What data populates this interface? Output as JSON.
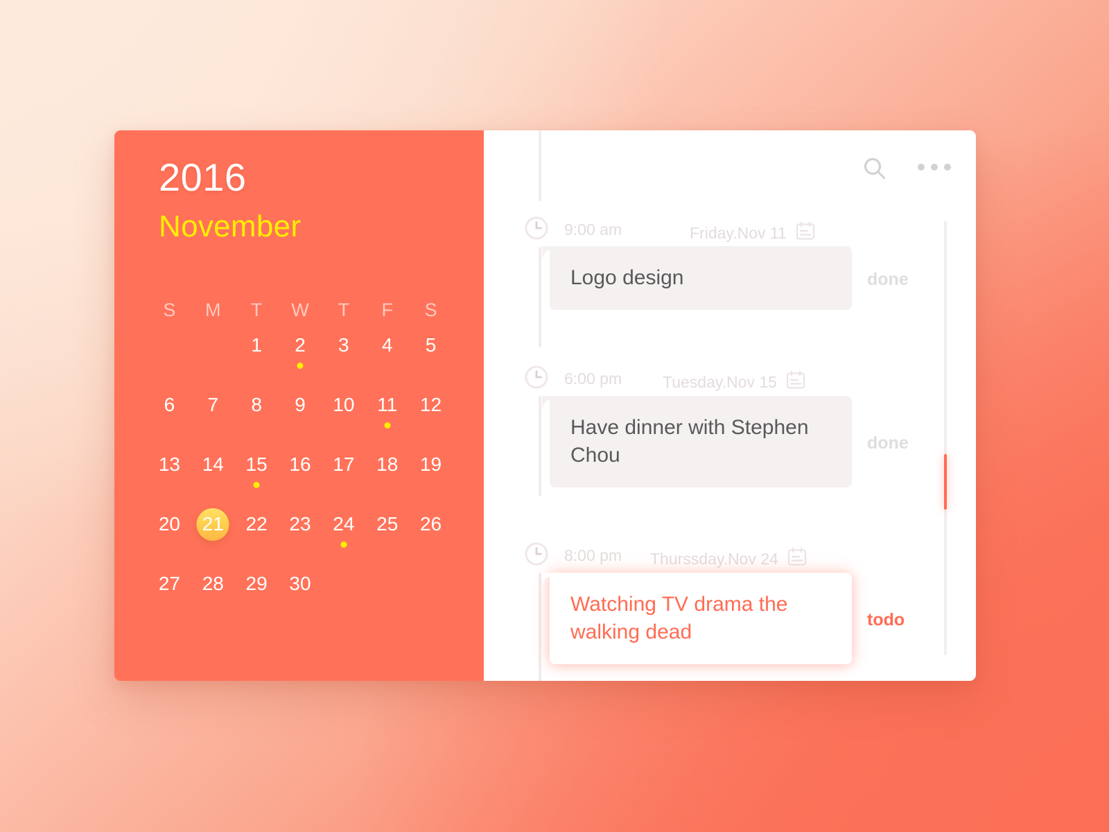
{
  "theme": {
    "panel_orange": "#FF7259",
    "accent_yellow": "#FFEF00",
    "selected_day_gradient_top": "#FFE067",
    "selected_day_gradient_bottom": "#FDB743",
    "todo_color": "#FF6C53",
    "done_color": "#DEDEDE",
    "card_bg": "#F5F1F1",
    "bg_gradient_from": "#FDE9DA",
    "bg_gradient_to": "#FB6E56"
  },
  "calendar": {
    "year": "2016",
    "month": "November",
    "weekday_headers": [
      "S",
      "M",
      "T",
      "W",
      "T",
      "F",
      "S"
    ],
    "leading_blanks": 2,
    "selected_day": 21,
    "days_with_events": [
      2,
      11,
      15,
      24
    ],
    "days": [
      {
        "num": "1"
      },
      {
        "num": "2"
      },
      {
        "num": "3"
      },
      {
        "num": "4"
      },
      {
        "num": "5"
      },
      {
        "num": "6"
      },
      {
        "num": "7"
      },
      {
        "num": "8"
      },
      {
        "num": "9"
      },
      {
        "num": "10"
      },
      {
        "num": "11"
      },
      {
        "num": "12"
      },
      {
        "num": "13"
      },
      {
        "num": "14"
      },
      {
        "num": "15"
      },
      {
        "num": "16"
      },
      {
        "num": "17"
      },
      {
        "num": "18"
      },
      {
        "num": "19"
      },
      {
        "num": "20"
      },
      {
        "num": "21"
      },
      {
        "num": "22"
      },
      {
        "num": "23"
      },
      {
        "num": "24"
      },
      {
        "num": "25"
      },
      {
        "num": "26"
      },
      {
        "num": "27"
      },
      {
        "num": "28"
      },
      {
        "num": "29"
      },
      {
        "num": "30"
      }
    ]
  },
  "toolbar": {
    "search_icon": "search-icon",
    "more_icon": "more-options-icon"
  },
  "agenda": {
    "entries": [
      {
        "time": "9:00 am",
        "date": "Friday.Nov 11",
        "title": "Logo design",
        "status": "done",
        "state": "done",
        "clock_icon": "clock-icon",
        "calendar_icon": "calendar-icon"
      },
      {
        "time": "6:00 pm",
        "date": "Tuesday.Nov 15",
        "title": "Have dinner with Stephen Chou",
        "status": "done",
        "state": "done",
        "clock_icon": "clock-icon",
        "calendar_icon": "calendar-icon"
      },
      {
        "time": "8:00 pm",
        "date": "Thurssday.Nov 24",
        "title": "Watching TV drama the walking dead",
        "status": "todo",
        "state": "todo",
        "clock_icon": "clock-icon",
        "calendar_icon": "calendar-icon"
      }
    ]
  },
  "scrollbar": {
    "orientation": "vertical",
    "thumb_position_percent": 54
  }
}
